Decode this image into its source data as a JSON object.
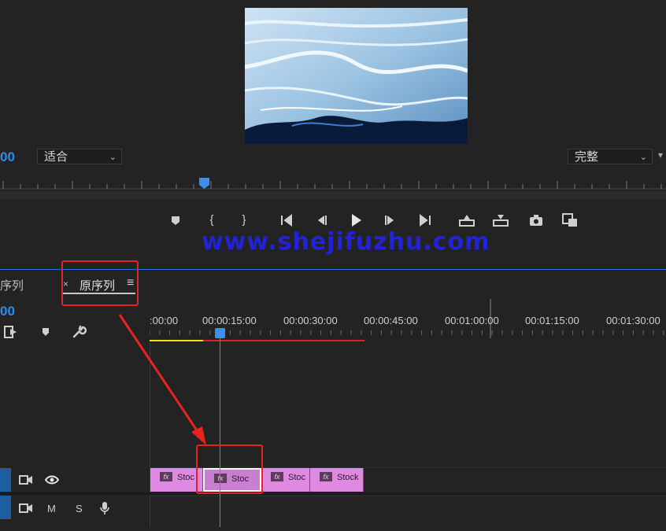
{
  "program_monitor": {
    "timecode": "00",
    "zoom_select": "适合",
    "quality_select": "完整"
  },
  "watermark": "www.shejifuzhu.com",
  "timeline_panel": {
    "left_tab_label": "序列",
    "close_symbol": "×",
    "active_tab_label": "原序列",
    "menu_symbol": "≡",
    "timecode": "00",
    "ruler_labels": [
      ":00:00",
      "00:00:15:00",
      "00:00:30:00",
      "00:00:45:00",
      "00:01:00:00",
      "00:01:15:00",
      "00:01:30:00"
    ],
    "clips": [
      {
        "fx": "fx",
        "name": "Stoc"
      },
      {
        "fx": "fx",
        "name": "Stoc"
      },
      {
        "fx": "fx",
        "name": "Stoc"
      },
      {
        "fx": "fx",
        "name": "Stock"
      }
    ],
    "audio_track": {
      "mute": "M",
      "solo": "S"
    }
  },
  "colors": {
    "accent": "#2d8ceb",
    "clip": "#e089e0",
    "annotation": "#e8231d"
  }
}
